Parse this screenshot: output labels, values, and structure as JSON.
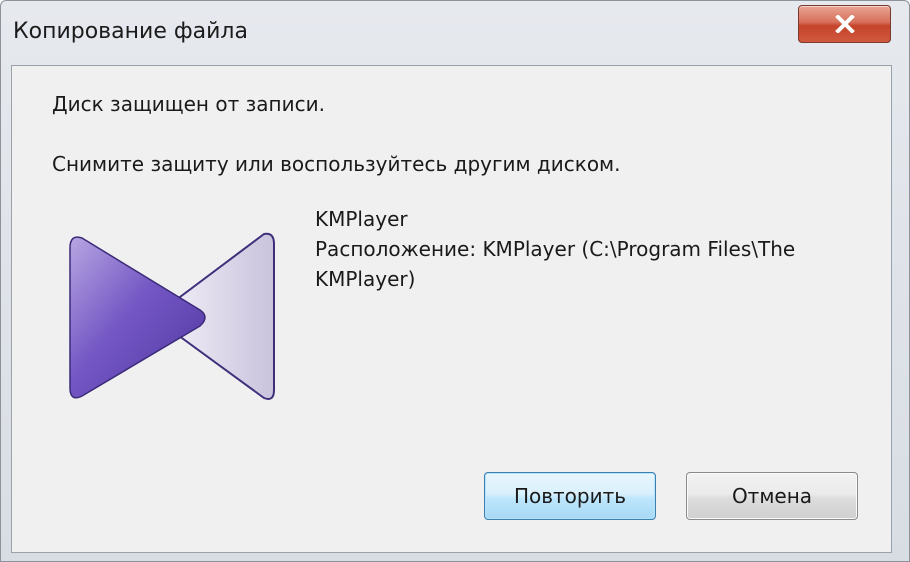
{
  "window": {
    "title": "Копирование файла"
  },
  "message": {
    "line1": "Диск защищен от записи.",
    "line2": "Снимите защиту или воспользуйтесь другим диском."
  },
  "file": {
    "name": "KMPlayer",
    "location_line1": "Расположение: KMPlayer (C:\\Program Files\\The",
    "location_line2": "KMPlayer)",
    "icon": "kmplayer-logo-icon"
  },
  "buttons": {
    "retry_label": "Повторить",
    "cancel_label": "Отмена",
    "close_icon": "close-icon"
  },
  "colors": {
    "close_button": "#c4442a",
    "logo_purple": "#6a4fb3",
    "default_button_border": "#3c7fb1"
  }
}
